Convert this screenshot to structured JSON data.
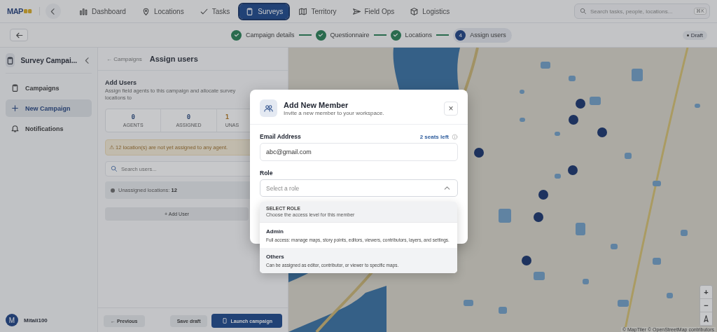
{
  "top_nav": {
    "logo": "MAP",
    "items": [
      {
        "label": "Dashboard",
        "selected": false
      },
      {
        "label": "Locations",
        "selected": false
      },
      {
        "label": "Tasks",
        "selected": false
      },
      {
        "label": "Surveys",
        "selected": true
      },
      {
        "label": "Territory",
        "selected": false
      },
      {
        "label": "Field Ops",
        "selected": false
      },
      {
        "label": "Logistics",
        "selected": false
      }
    ],
    "search": {
      "placeholder": "Search tasks, people, locations...",
      "shortcut": "⌘K"
    }
  },
  "stepper": {
    "steps": [
      {
        "label": "Campaign details",
        "done": true
      },
      {
        "label": "Questionnaire",
        "done": true
      },
      {
        "label": "Locations",
        "done": true
      },
      {
        "label": "Assign users",
        "done": false,
        "number": "4"
      }
    ],
    "status": "Draft"
  },
  "sidebar": {
    "title": "Survey Campai...",
    "items": [
      {
        "label": "Campaigns",
        "selected": false
      },
      {
        "label": "New Campaign",
        "selected": true
      },
      {
        "label": "Notifications",
        "selected": false
      }
    ],
    "user": {
      "initial": "M",
      "name": "Mitali100"
    }
  },
  "panel": {
    "breadcrumb": "← Campaigns",
    "title": "Assign users",
    "section_title": "Add Users",
    "section_subtitle": "Assign field agents to this campaign and allocate survey locations to",
    "stats": [
      {
        "value": "0",
        "label": "AGENTS"
      },
      {
        "value": "0",
        "label": "ASSIGNED"
      },
      {
        "value": "1",
        "label": "UNAS"
      }
    ],
    "warning": "⚠ 12 location(s) are not yet assigned to any agent.",
    "search": {
      "placeholder": "Search users..."
    },
    "unassigned": "Unassigned locations: **12**",
    "add_button": "+ Add User",
    "footer": {
      "previous": "← Previous",
      "save": "Save draft",
      "launch": "Launch campaign"
    }
  },
  "map": {
    "attribution": "© MapTiler © OpenStreetMap contributors",
    "zoom_in": "+",
    "zoom_out": "−"
  },
  "modal": {
    "title": "Add New Member",
    "subtitle": "Invite a new member to your workspace.",
    "close": "×",
    "email": {
      "label": "Email Address",
      "seats": "2 seats left",
      "value": "abc@gmail.com"
    },
    "role": {
      "label": "Role",
      "placeholder": "Select a role",
      "expanded": true
    },
    "dropdown": {
      "heading": "SELECT ROLE",
      "hint": "Choose the access level for this member",
      "options": [
        {
          "title": "Admin",
          "description": "Full access: manage maps, story points, editors, viewers, contributors, layers, and settings.",
          "selected": false,
          "highlighted": false
        },
        {
          "title": "Others",
          "description": "Can be assigned as editor, contributor, or viewer to specific maps.",
          "selected": false,
          "highlighted": true
        }
      ]
    }
  }
}
